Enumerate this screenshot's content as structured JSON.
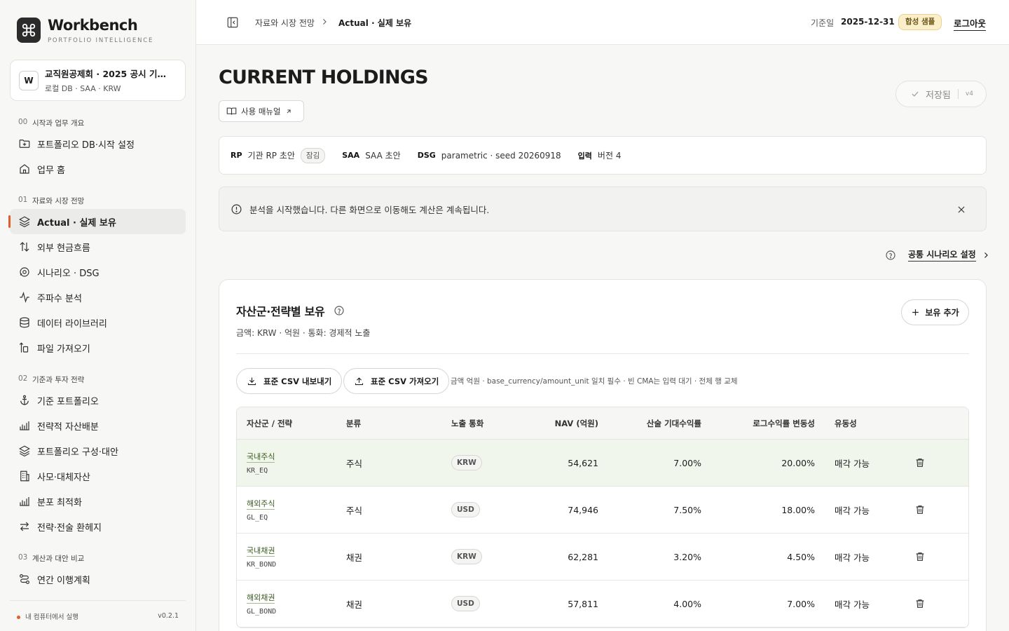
{
  "brand": {
    "title": "Workbench",
    "subtitle": "PORTFOLIO INTELLIGENCE",
    "logo_icon": "command-icon"
  },
  "workspace": {
    "avatar": "W",
    "name": "교직원공제회 · 2025 공시 기반 ...",
    "meta": "로컬 DB · SAA · KRW"
  },
  "nav": {
    "sections": [
      {
        "num": "00",
        "label": "시작과 업무 개요"
      },
      {
        "num": "01",
        "label": "자료와 시장 전망"
      },
      {
        "num": "02",
        "label": "기준과 투자 전략"
      },
      {
        "num": "03",
        "label": "계산과 대안 비교"
      }
    ],
    "items": [
      {
        "label": "포트폴리오 DB·시작 설정",
        "icon": "folder-plus-icon"
      },
      {
        "label": "업무 홈",
        "icon": "home-icon"
      },
      {
        "label": "Actual · 실제 보유",
        "icon": "layers-icon",
        "active": true
      },
      {
        "label": "외부 현금흐름",
        "icon": "arrows-updown-icon"
      },
      {
        "label": "시나리오 · DSG",
        "icon": "scenario-icon"
      },
      {
        "label": "주파수 분석",
        "icon": "pulse-icon"
      },
      {
        "label": "데이터 라이브러리",
        "icon": "database-icon"
      },
      {
        "label": "파일 가져오기",
        "icon": "file-import-icon"
      },
      {
        "label": "기준 포트폴리오",
        "icon": "anchor-icon"
      },
      {
        "label": "전략적 자산배분",
        "icon": "bar-chart-icon"
      },
      {
        "label": "포트폴리오 구성·대안",
        "icon": "layers-icon"
      },
      {
        "label": "사모·대체자산",
        "icon": "building-icon"
      },
      {
        "label": "분포 최적화",
        "icon": "bar-chart-icon"
      },
      {
        "label": "전략·전술 환헤지",
        "icon": "swap-icon"
      },
      {
        "label": "연간 이행계획",
        "icon": "route-icon"
      }
    ],
    "footer_status": "내 컴퓨터에서 실행",
    "version": "v0.2.1",
    "status_color": "#e25c2c"
  },
  "header": {
    "breadcrumb_parent": "자료와 시장 전망",
    "breadcrumb_current": "Actual · 실제 보유",
    "basis_label": "기준일",
    "basis_date": "2025-12-31",
    "badge": "합성 샘플",
    "logout": "로그아웃"
  },
  "page": {
    "title": "CURRENT HOLDINGS",
    "manual_label": "사용 매뉴얼",
    "saved_label": "저장됨",
    "saved_version": "v4"
  },
  "meta": {
    "rp_key": "RP",
    "rp_value": "기관 RP 초안",
    "rp_lock": "잠김",
    "saa_key": "SAA",
    "saa_value": "SAA 초안",
    "dsg_key": "DSG",
    "dsg_value": "parametric · seed 20260918",
    "input_key": "입력",
    "input_value": "버전 4"
  },
  "notice": {
    "text": "분석을 시작했습니다. 다른 화면으로 이동해도 계산은 계속됩니다."
  },
  "scenario_link": "공통 시나리오 설정",
  "holdings": {
    "title": "자산군·전략별 보유",
    "subtitle": "금액: KRW · 억원 · 통화: 경제적 노출",
    "add_label": "보유 추가",
    "export_label": "표준 CSV 내보내기",
    "import_label": "표준 CSV 가져오기",
    "csv_note": "금액 억원 · base_currency/amount_unit 일치 필수 · 빈 CMA는 입력 대기 · 전체 행 교체",
    "columns": [
      "자산군 / 전략",
      "분류",
      "노출 통화",
      "NAV (억원)",
      "산술 기대수익률",
      "로그수익률 변동성",
      "유동성"
    ],
    "rows": [
      {
        "name": "국내주식",
        "code": "KR_EQ",
        "class": "주식",
        "currency": "KRW",
        "nav": "54,621",
        "exp_return": "7.00%",
        "vol": "20.00%",
        "liquidity": "매각 가능"
      },
      {
        "name": "해외주식",
        "code": "GL_EQ",
        "class": "주식",
        "currency": "USD",
        "nav": "74,946",
        "exp_return": "7.50%",
        "vol": "18.00%",
        "liquidity": "매각 가능"
      },
      {
        "name": "국내채권",
        "code": "KR_BOND",
        "class": "채권",
        "currency": "KRW",
        "nav": "62,281",
        "exp_return": "3.20%",
        "vol": "4.50%",
        "liquidity": "매각 가능"
      },
      {
        "name": "해외채권",
        "code": "GL_BOND",
        "class": "채권",
        "currency": "USD",
        "nav": "57,811",
        "exp_return": "4.00%",
        "vol": "7.00%",
        "liquidity": "매각 가능"
      }
    ]
  }
}
